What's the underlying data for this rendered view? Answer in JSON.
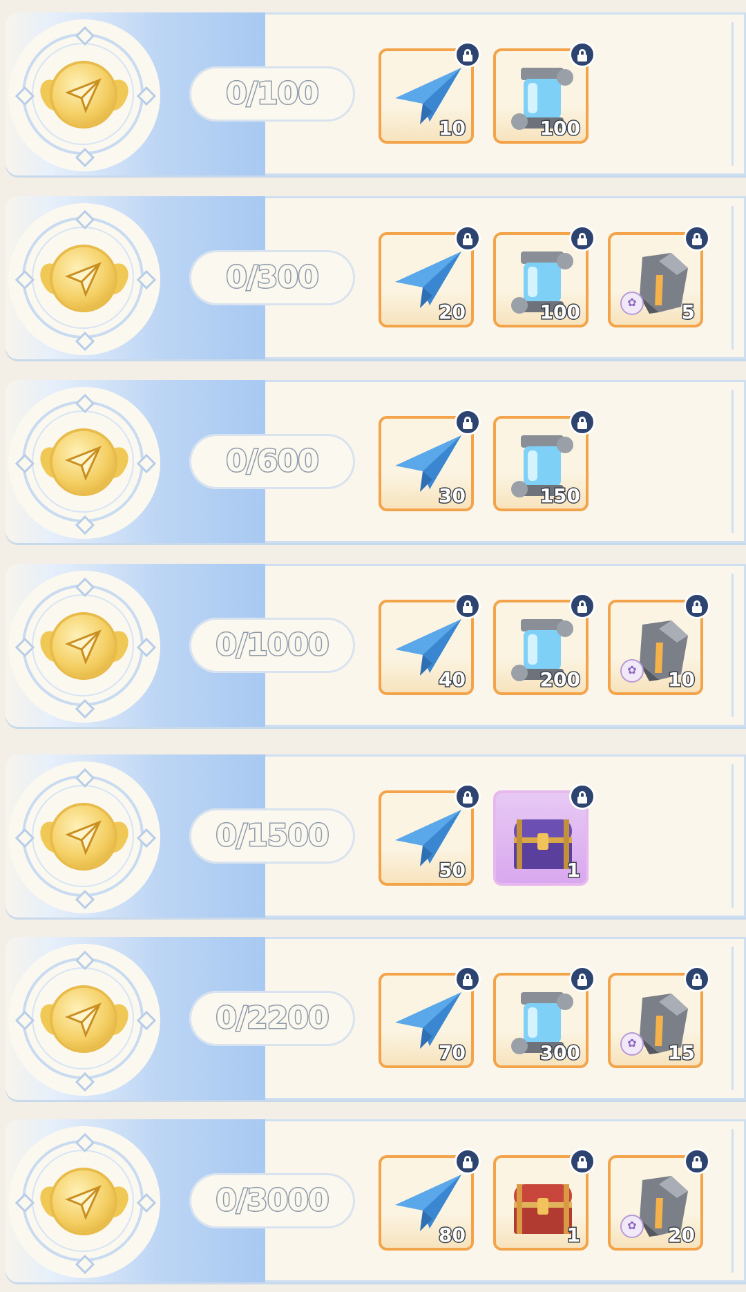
{
  "rows": [
    {
      "progress": "0/100",
      "rewards": [
        {
          "icon": "paper-plane-icon",
          "qty": "10"
        },
        {
          "icon": "energy-canister-icon",
          "qty": "100"
        }
      ]
    },
    {
      "progress": "0/300",
      "rewards": [
        {
          "icon": "paper-plane-icon",
          "qty": "20"
        },
        {
          "icon": "energy-canister-icon",
          "qty": "100"
        },
        {
          "icon": "ore-stone-icon",
          "qty": "5"
        }
      ]
    },
    {
      "progress": "0/600",
      "rewards": [
        {
          "icon": "paper-plane-icon",
          "qty": "30"
        },
        {
          "icon": "energy-canister-icon",
          "qty": "150"
        }
      ]
    },
    {
      "progress": "0/1000",
      "rewards": [
        {
          "icon": "paper-plane-icon",
          "qty": "40"
        },
        {
          "icon": "energy-canister-icon",
          "qty": "200"
        },
        {
          "icon": "ore-stone-icon",
          "qty": "10"
        }
      ]
    },
    {
      "progress": "0/1500",
      "rewards": [
        {
          "icon": "paper-plane-icon",
          "qty": "50"
        },
        {
          "icon": "purple-chest-icon",
          "qty": "1"
        }
      ]
    },
    {
      "progress": "0/2200",
      "rewards": [
        {
          "icon": "paper-plane-icon",
          "qty": "70"
        },
        {
          "icon": "energy-canister-icon",
          "qty": "300"
        },
        {
          "icon": "ore-stone-icon",
          "qty": "15"
        }
      ]
    },
    {
      "progress": "0/3000",
      "rewards": [
        {
          "icon": "paper-plane-icon",
          "qty": "80"
        },
        {
          "icon": "red-chest-icon",
          "qty": "1"
        },
        {
          "icon": "ore-stone-icon",
          "qty": "20"
        }
      ]
    }
  ],
  "colors": {
    "frame": "#c9dbf0",
    "item_border": "#f3a44a",
    "purple_item": "#d9a8ee",
    "lock": "#2e4470"
  }
}
